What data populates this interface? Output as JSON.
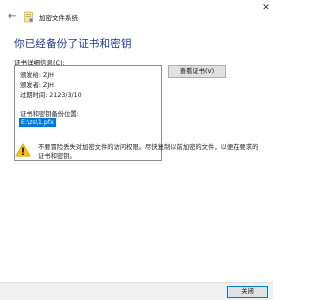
{
  "window": {
    "title": "加密文件系统",
    "close_glyph": "✕",
    "back_glyph": "←"
  },
  "heading": "你已经备份了证书和密钥",
  "details": {
    "label": "证书详细信息(C):",
    "issued_to": "颁发给: ZJH",
    "issued_by": "颁发者: ZJH",
    "expires": "过期时间: 2123/3/10",
    "backup_location_label": "证书和密钥备份位置:",
    "backup_path": "E:\\zs\\1.pfx"
  },
  "view_cert_button": "查看证书(V)",
  "warning": {
    "text": "不要冒险丢失对加密文件的访问权限。尽快复制以前加密的文件，以便在要求的证书和密钥。"
  },
  "footer": {
    "close_button": "关闭"
  },
  "colors": {
    "heading": "#1a3a8c",
    "selection": "#0078d7",
    "warning_yellow": "#f5c400"
  }
}
